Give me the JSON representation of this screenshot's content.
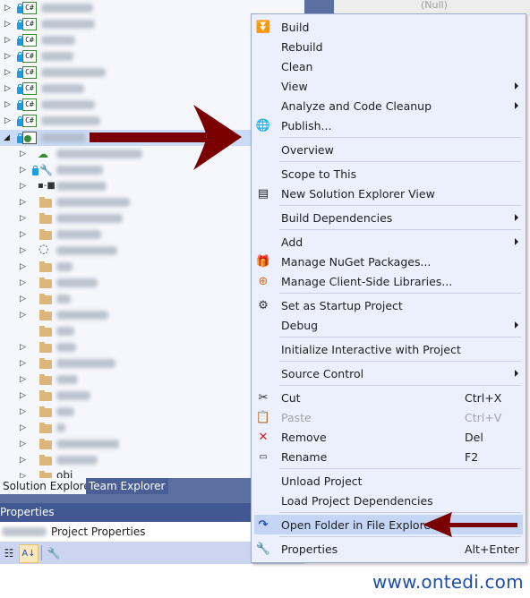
{
  "background": {
    "null_value": "(Null)"
  },
  "solution_explorer": {
    "projects": [
      {
        "type": "csharp",
        "name_blurred": true
      },
      {
        "type": "csharp",
        "name_blurred": true
      },
      {
        "type": "csharp",
        "name_blurred": true
      },
      {
        "type": "csharp",
        "name_blurred": true
      },
      {
        "type": "csharp",
        "name_blurred": true
      },
      {
        "type": "csharp",
        "name_blurred": true
      },
      {
        "type": "csharp",
        "name_blurred": true
      },
      {
        "type": "csharp",
        "name_blurred": true
      },
      {
        "type": "web",
        "name_blurred": true,
        "expanded": true,
        "selected": true
      }
    ],
    "children": [
      {
        "icon": "service-reference-icon",
        "expandable": true
      },
      {
        "icon": "wrench-icon",
        "expandable": true,
        "locked": true
      },
      {
        "icon": "references-icon",
        "expandable": true
      },
      {
        "icon": "folder-icon",
        "expandable": true
      },
      {
        "icon": "folder-icon",
        "expandable": true
      },
      {
        "icon": "folder-icon",
        "expandable": true
      },
      {
        "icon": "themes-icon",
        "expandable": true
      },
      {
        "icon": "folder-icon",
        "expandable": true
      },
      {
        "icon": "folder-icon",
        "expandable": true
      },
      {
        "icon": "folder-icon",
        "expandable": true
      },
      {
        "icon": "folder-icon",
        "expandable": true
      },
      {
        "icon": "folder-icon",
        "expandable": false
      },
      {
        "icon": "folder-icon",
        "expandable": true
      },
      {
        "icon": "folder-icon",
        "expandable": true
      },
      {
        "icon": "folder-icon",
        "expandable": true
      },
      {
        "icon": "folder-icon",
        "expandable": true
      },
      {
        "icon": "folder-icon",
        "expandable": true
      },
      {
        "icon": "folder-icon",
        "expandable": true
      },
      {
        "icon": "folder-icon",
        "expandable": true
      },
      {
        "icon": "folder-icon",
        "expandable": true
      },
      {
        "icon": "folder-icon",
        "expandable": true,
        "label": "obj"
      }
    ],
    "cs_label": "C#"
  },
  "tabs": {
    "solution_explorer": "Solution Explorer",
    "team_explorer": "Team Explorer"
  },
  "properties": {
    "header": "Properties",
    "object_suffix": "Project Properties"
  },
  "context_menu": {
    "items": [
      {
        "label": "Build",
        "icon": "build-icon"
      },
      {
        "label": "Rebuild"
      },
      {
        "label": "Clean"
      },
      {
        "label": "View",
        "submenu": true
      },
      {
        "label": "Analyze and Code Cleanup",
        "submenu": true
      },
      {
        "label": "Publish...",
        "icon": "publish-icon"
      },
      {
        "label": "Overview"
      },
      {
        "label": "Scope to This"
      },
      {
        "label": "New Solution Explorer View",
        "icon": "new-view-icon"
      },
      {
        "label": "Build Dependencies",
        "submenu": true
      },
      {
        "label": "Add",
        "submenu": true
      },
      {
        "label": "Manage NuGet Packages...",
        "icon": "nuget-icon"
      },
      {
        "label": "Manage Client-Side Libraries...",
        "icon": "client-libraries-icon"
      },
      {
        "label": "Set as Startup Project",
        "icon": "gear-icon"
      },
      {
        "label": "Debug",
        "submenu": true
      },
      {
        "label": "Initialize Interactive with Project"
      },
      {
        "label": "Source Control",
        "submenu": true
      },
      {
        "label": "Cut",
        "icon": "cut-icon",
        "shortcut": "Ctrl+X"
      },
      {
        "label": "Paste",
        "icon": "paste-icon",
        "shortcut": "Ctrl+V",
        "disabled": true
      },
      {
        "label": "Remove",
        "icon": "remove-icon",
        "shortcut": "Del"
      },
      {
        "label": "Rename",
        "icon": "rename-icon",
        "shortcut": "F2"
      },
      {
        "label": "Unload Project"
      },
      {
        "label": "Load Project Dependencies"
      },
      {
        "label": "Open Folder in File Explorer",
        "icon": "open-folder-icon",
        "highlighted": true
      },
      {
        "label": "Properties",
        "icon": "wrench-icon",
        "shortcut": "Alt+Enter"
      }
    ]
  },
  "annotation": {
    "arrow_color": "#7a0000"
  },
  "watermark": "www.ontedi.com"
}
